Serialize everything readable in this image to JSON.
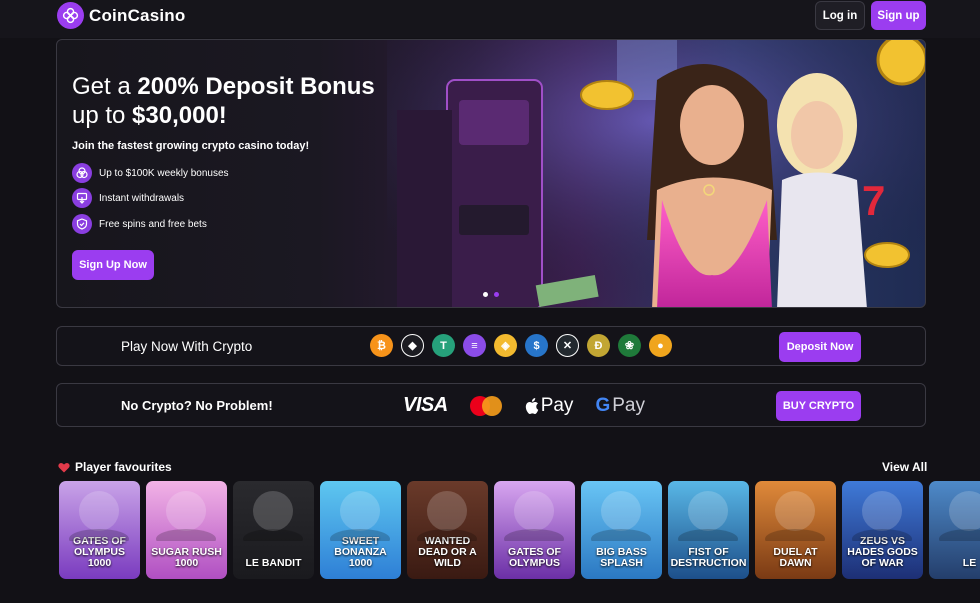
{
  "header": {
    "logo_text": "CoinCasino",
    "login_label": "Log in",
    "signup_label": "Sign up"
  },
  "hero": {
    "title_line1_prefix": "Get a ",
    "title_line1_bold": "200% Deposit Bonus",
    "title_line2_prefix": "up to ",
    "title_line2_bold": "$30,000!",
    "subtitle": "Join the fastest growing crypto casino today!",
    "features": [
      {
        "icon": "coins-icon",
        "label": "Up to $100K weekly bonuses"
      },
      {
        "icon": "withdraw-icon",
        "label": "Instant withdrawals"
      },
      {
        "icon": "shield-icon",
        "label": "Free spins and free bets"
      }
    ],
    "cta_label": "Sign Up Now"
  },
  "crypto_bar": {
    "label": "Play Now With Crypto",
    "coins": [
      {
        "name": "bitcoin-icon",
        "symbol": "₿",
        "color": "#f7931a"
      },
      {
        "name": "ethereum-icon",
        "symbol": "◆",
        "color": "#1c1c22"
      },
      {
        "name": "tether-icon",
        "symbol": "T",
        "color": "#26a17b"
      },
      {
        "name": "solana-icon",
        "symbol": "≡",
        "color": "#8b4ce8"
      },
      {
        "name": "bnb-icon",
        "symbol": "◈",
        "color": "#f3ba2f"
      },
      {
        "name": "usdc-icon",
        "symbol": "$",
        "color": "#2775ca"
      },
      {
        "name": "xrp-icon",
        "symbol": "✕",
        "color": "#23292f"
      },
      {
        "name": "dogecoin-icon",
        "symbol": "Ð",
        "color": "#c2a633"
      },
      {
        "name": "rose-coin-icon",
        "symbol": "❀",
        "color": "#1f7a3a"
      },
      {
        "name": "shiba-coin-icon",
        "symbol": "●",
        "color": "#f0a51d"
      }
    ],
    "button_label": "Deposit Now"
  },
  "fiat_bar": {
    "label": "No Crypto? No Problem!",
    "payments": {
      "visa": "VISA",
      "apple_pay": "Pay",
      "google_pay_g": "G",
      "google_pay_text": "Pay"
    },
    "button_label": "BUY CRYPTO"
  },
  "favourites": {
    "title": "Player favourites",
    "view_all": "View All",
    "games": [
      {
        "title": "GATES OF OLYMPUS 1000",
        "color_top": "#c9a3e8",
        "color_bottom": "#7a3bbf"
      },
      {
        "title": "SUGAR RUSH 1000",
        "color_top": "#f2b3e6",
        "color_bottom": "#b04fc2"
      },
      {
        "title": "LE BANDIT",
        "color_top": "#2a2a2e",
        "color_bottom": "#1a1a1e"
      },
      {
        "title": "SWEET BONANZA 1000",
        "color_top": "#5ec7f0",
        "color_bottom": "#2e7fd6"
      },
      {
        "title": "WANTED DEAD OR A WILD",
        "color_top": "#6a3a2a",
        "color_bottom": "#3a1a12"
      },
      {
        "title": "GATES OF OLYMPUS",
        "color_top": "#d8a6f0",
        "color_bottom": "#6b2fa6"
      },
      {
        "title": "BIG BASS SPLASH",
        "color_top": "#69c5f5",
        "color_bottom": "#2b78c2"
      },
      {
        "title": "FIST OF DESTRUCTION",
        "color_top": "#59b7e6",
        "color_bottom": "#1d4f8a"
      },
      {
        "title": "DUEL AT DAWN",
        "color_top": "#e08a3a",
        "color_bottom": "#7a3a14"
      },
      {
        "title": "ZEUS VS HADES GODS OF WAR",
        "color_top": "#3f7ad8",
        "color_bottom": "#1d2f75"
      },
      {
        "title": "LE",
        "color_top": "#4e8ac9",
        "color_bottom": "#243e6b"
      }
    ]
  }
}
